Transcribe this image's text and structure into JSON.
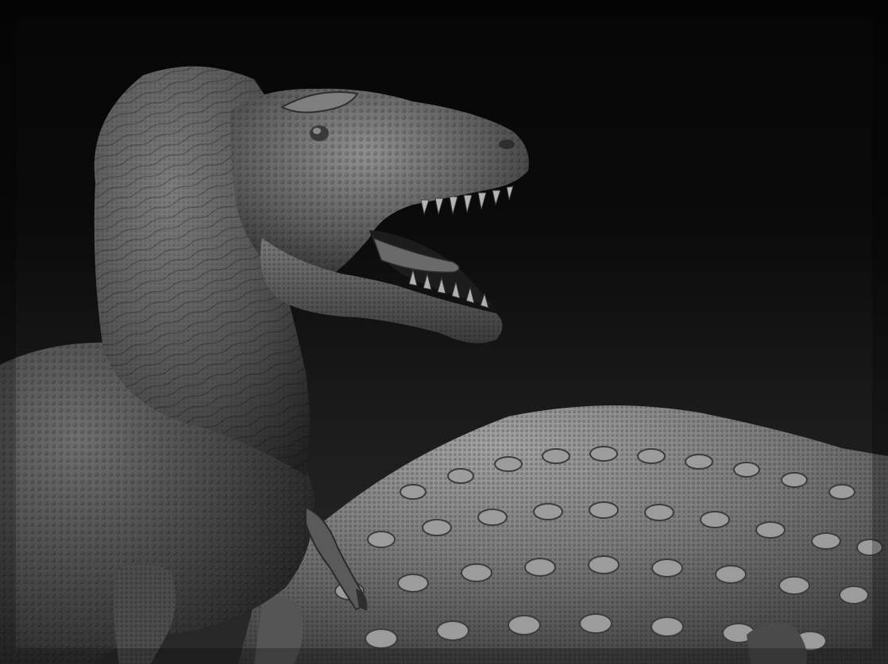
{
  "scene": {
    "subject": "sculpt-render",
    "colors": {
      "background_top": "#060606",
      "background_bottom": "#2a2a2a",
      "clay_light": "#9a9a9a",
      "clay_mid": "#6a6a6a",
      "clay_dark": "#2e2e2e"
    }
  }
}
